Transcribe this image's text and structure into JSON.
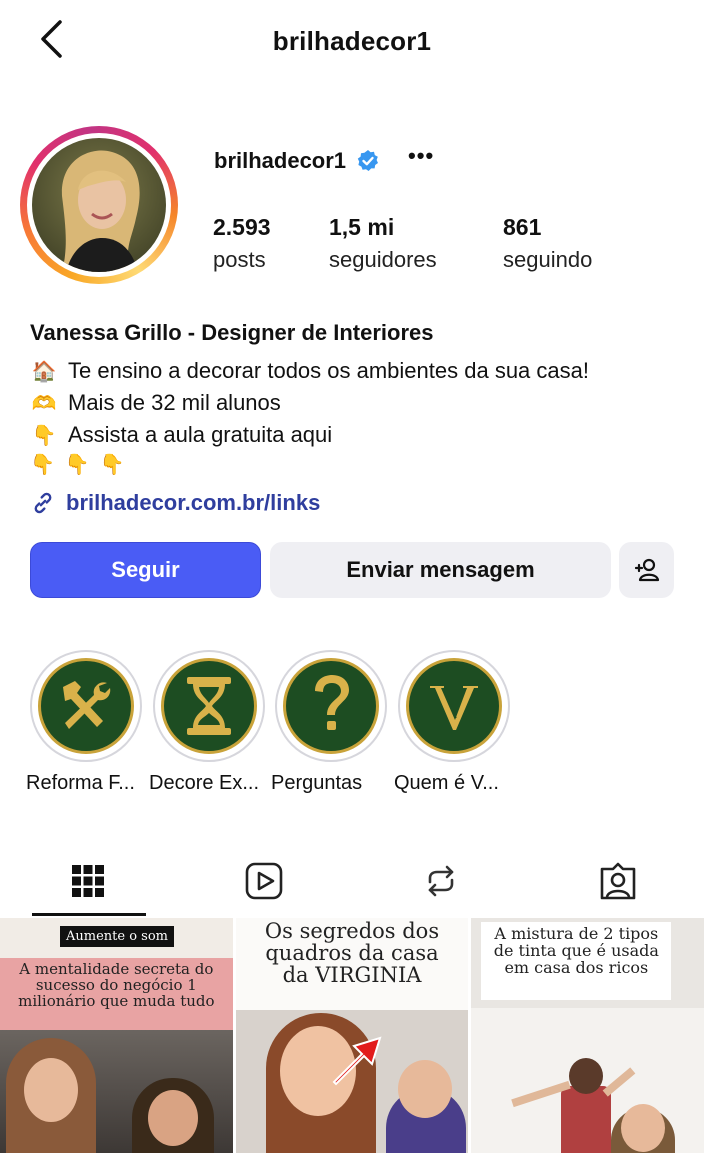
{
  "header": {
    "title": "brilhadecor1"
  },
  "profile": {
    "username": "brilhadecor1",
    "stats": [
      {
        "value": "2.593",
        "label": "posts"
      },
      {
        "value": "1,5 mi",
        "label": "seguidores"
      },
      {
        "value": "861",
        "label": "seguindo"
      }
    ],
    "display_name": "Vanessa Grillo - Designer de Interiores",
    "bio_lines": [
      {
        "emoji": "🏠",
        "text": "Te ensino a decorar todos os ambientes da sua casa!"
      },
      {
        "emoji": "🫶",
        "text": "Mais de 32 mil alunos"
      },
      {
        "emoji": "👇",
        "text": "Assista a aula gratuita aqui"
      }
    ],
    "bio_emojis_line": "👇👇👇",
    "link": "brilhadecor.com.br/links"
  },
  "actions": {
    "follow": "Seguir",
    "message": "Enviar mensagem"
  },
  "highlights": [
    {
      "label": "Reforma F...",
      "icon": "tools-icon"
    },
    {
      "label": "Decore Ex...",
      "icon": "hourglass-icon"
    },
    {
      "label": "Perguntas",
      "icon": "question-icon"
    },
    {
      "label": "Quem é V...",
      "icon": "letter-v-icon"
    }
  ],
  "posts": [
    {
      "tag": "Aumente o som",
      "caption": "A mentalidade secreta do sucesso do negócio 1 milionário que muda tudo"
    },
    {
      "caption": "Os segredos dos quadros da casa da VIRGINIA"
    },
    {
      "caption": "A mistura de 2 tipos de tinta que é usada em casa dos ricos"
    }
  ],
  "colors": {
    "accent": "#4a5cf5",
    "link": "#2f3e9e",
    "verified": "#3897f0",
    "highlight_bg": "#1d4d22",
    "highlight_gold": "#c9a33a"
  }
}
